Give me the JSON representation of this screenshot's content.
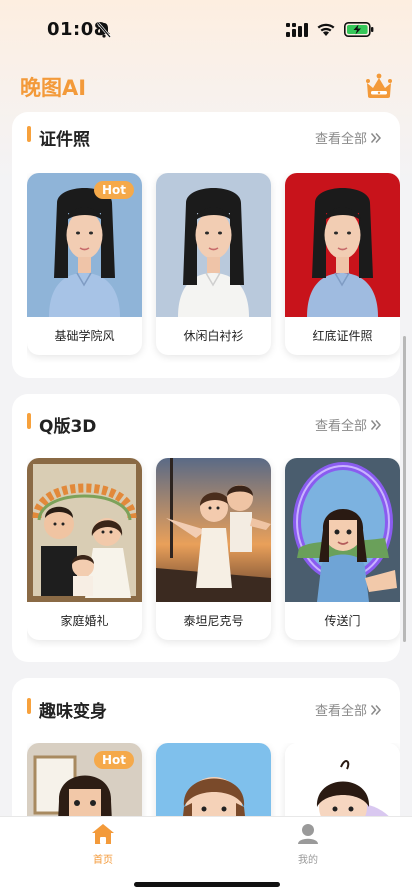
{
  "status_bar": {
    "time": "01:08"
  },
  "header": {
    "title": "晚图AI"
  },
  "sections": [
    {
      "title": "证件照",
      "more": "查看全部",
      "cards": [
        {
          "label": "基础学院风",
          "badge": "Hot"
        },
        {
          "label": "休闲白衬衫",
          "badge": ""
        },
        {
          "label": "红底证件照",
          "badge": ""
        }
      ]
    },
    {
      "title": "Q版3D",
      "more": "查看全部",
      "cards": [
        {
          "label": "家庭婚礼",
          "badge": ""
        },
        {
          "label": "泰坦尼克号",
          "badge": ""
        },
        {
          "label": "传送门",
          "badge": ""
        }
      ]
    },
    {
      "title": "趣味变身",
      "more": "查看全部",
      "cards": [
        {
          "label": "",
          "badge": "Hot"
        },
        {
          "label": "",
          "badge": ""
        },
        {
          "label": "",
          "badge": ""
        }
      ]
    }
  ],
  "tabbar": {
    "home": "首页",
    "mine": "我的"
  },
  "colors": {
    "accent": "#f39a3a",
    "tab_active": "#f39a3a",
    "tab_inactive": "#9a9a9a"
  }
}
